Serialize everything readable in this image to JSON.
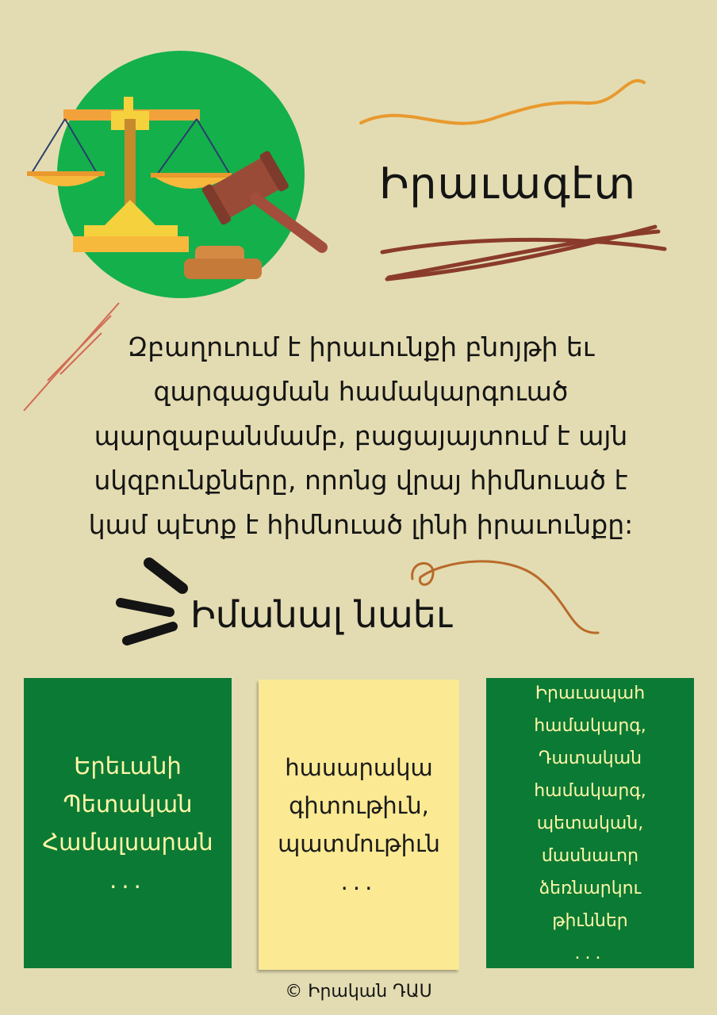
{
  "title": "Իրաւագէտ",
  "description_lines": [
    "Զբաղուում է իրաւունքի բնոյթի եւ",
    "զարգացման համակարգուած",
    "պարզաբանմամբ, բացայայտում է այն",
    "սկզբունքները, որոնց վրայ հիմնուած է",
    "կամ պէտք է հիմնուած լինի իրաւունքը:"
  ],
  "see_also": "Իմանալ նաեւ",
  "cards": [
    {
      "lines": [
        "Երեւանի",
        "Պետական",
        "Համալսարան"
      ],
      "dots": "..."
    },
    {
      "lines": [
        "հասարակա",
        "գիտութիւն,",
        "պատմութիւն"
      ],
      "dots": "..."
    },
    {
      "lines": [
        "Իրաւապահ",
        "համակարգ,",
        "Դատական",
        "համակարգ,",
        "պետական,",
        "մասնաւոր",
        "ձեռնարկու",
        "թիւններ"
      ],
      "dots": "..."
    }
  ],
  "footer": "© Իրական ԴԱՍ",
  "icons": [
    "scales-of-justice-icon",
    "gavel-icon"
  ],
  "colors": {
    "background": "#e3dcb2",
    "green": "#0b7a34",
    "circle_green": "#14b04c",
    "yellow_note": "#fbe993",
    "accent_orange": "#e9992e",
    "accent_brown": "#8a3b2b",
    "card_text": "#fff6a8"
  }
}
